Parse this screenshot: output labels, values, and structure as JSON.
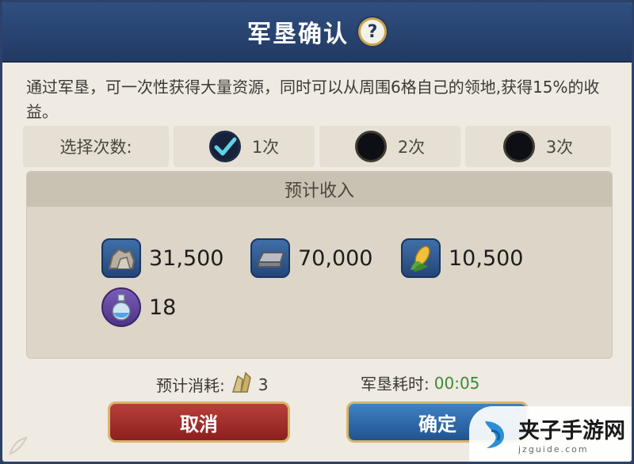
{
  "dialog": {
    "title": "军垦确认",
    "help_icon": "?",
    "description": "通过军垦，可一次性获得大量资源，同时可以从周围6格自己的领地,获得15%的收益。"
  },
  "select": {
    "label": "选择次数:",
    "options": [
      {
        "label": "1次",
        "checked": true
      },
      {
        "label": "2次",
        "checked": false
      },
      {
        "label": "3次",
        "checked": false
      }
    ]
  },
  "income": {
    "title": "预计收入",
    "resources": [
      {
        "icon": "stone-icon",
        "value": "31,500"
      },
      {
        "icon": "iron-ingot-icon",
        "value": "70,000"
      },
      {
        "icon": "corn-icon",
        "value": "10,500"
      },
      {
        "icon": "potion-icon",
        "value": "18"
      }
    ]
  },
  "footer": {
    "cost_label": "预计消耗:",
    "cost_value": "3",
    "time_label": "军垦耗时:",
    "time_value": "00:05"
  },
  "buttons": {
    "cancel": "取消",
    "confirm": "确定"
  },
  "watermark": {
    "main": "夹子手游网",
    "sub": "jzguide.com"
  },
  "colors": {
    "title_bar": "#2a4675",
    "cancel": "#a0302c",
    "confirm": "#2f6aab",
    "time": "#3d8a3a"
  }
}
